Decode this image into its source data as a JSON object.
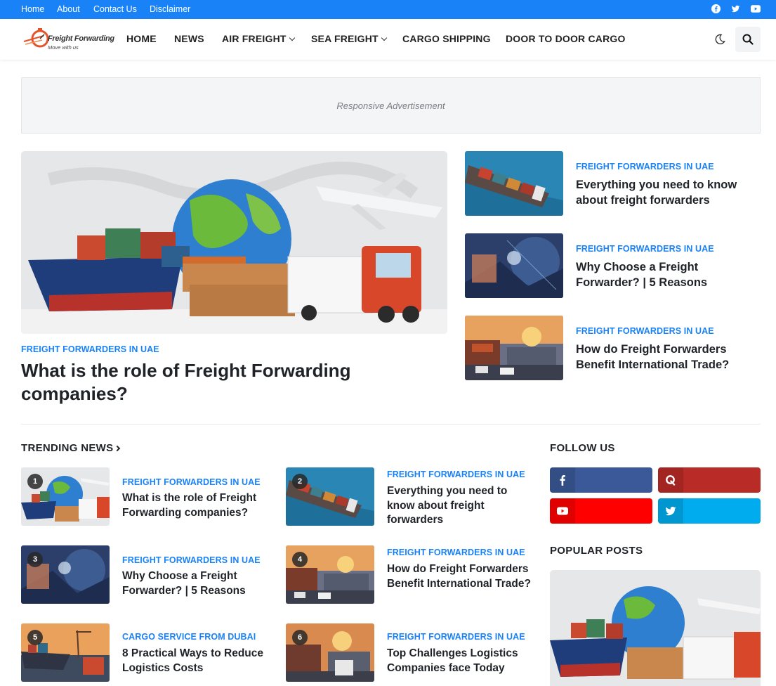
{
  "topbar": {
    "links": [
      "Home",
      "About",
      "Contact Us",
      "Disclaimer"
    ],
    "social_icons": [
      "facebook-icon",
      "twitter-icon",
      "youtube-icon"
    ]
  },
  "header": {
    "logo_text": "Freight Forwarding",
    "logo_tagline": "Move with us",
    "nav": [
      "HOME",
      "NEWS",
      "AIR FREIGHT",
      "SEA FREIGHT",
      "CARGO SHIPPING",
      "DOOR TO DOOR CARGO"
    ]
  },
  "ad": {
    "label": "Responsive Advertisement"
  },
  "featured": {
    "main": {
      "category": "FREIGHT FORWARDERS IN UAE",
      "title": "What is the role of Freight Forwarding companies?"
    },
    "side": [
      {
        "category": "FREIGHT FORWARDERS IN UAE",
        "title": "Everything you need to know about freight forwarders"
      },
      {
        "category": "FREIGHT FORWARDERS IN UAE",
        "title": "Why Choose a Freight Forwarder? | 5 Reasons"
      },
      {
        "category": "FREIGHT FORWARDERS IN UAE",
        "title": "How do Freight Forwarders Benefit International Trade?"
      }
    ]
  },
  "trending": {
    "heading": "TRENDING NEWS",
    "items": [
      {
        "rank": "1",
        "category": "FREIGHT FORWARDERS IN UAE",
        "title": "What is the role of Freight Forwarding companies?"
      },
      {
        "rank": "2",
        "category": "FREIGHT FORWARDERS IN UAE",
        "title": "Everything you need to know about freight forwarders"
      },
      {
        "rank": "3",
        "category": "FREIGHT FORWARDERS IN UAE",
        "title": "Why Choose a Freight Forwarder? | 5 Reasons"
      },
      {
        "rank": "4",
        "category": "FREIGHT FORWARDERS IN UAE",
        "title": "How do Freight Forwarders Benefit International Trade?"
      },
      {
        "rank": "5",
        "category": "CARGO SERVICE FROM DUBAI",
        "title": "8 Practical Ways to Reduce Logistics Costs"
      },
      {
        "rank": "6",
        "category": "FREIGHT FORWARDERS IN UAE",
        "title": "Top Challenges Logistics Companies face Today"
      }
    ]
  },
  "sidebar": {
    "follow_heading": "FOLLOW US",
    "follow_buttons": [
      {
        "icon": "facebook-icon",
        "color": "#3b5998"
      },
      {
        "icon": "quora-icon",
        "color": "#b92b27"
      },
      {
        "icon": "youtube-icon",
        "color": "#ff0000"
      },
      {
        "icon": "twitter-icon",
        "color": "#00acee"
      }
    ],
    "popular_heading": "POPULAR POSTS"
  },
  "colors": {
    "accent": "#1a82f7",
    "text": "#1f2328"
  }
}
